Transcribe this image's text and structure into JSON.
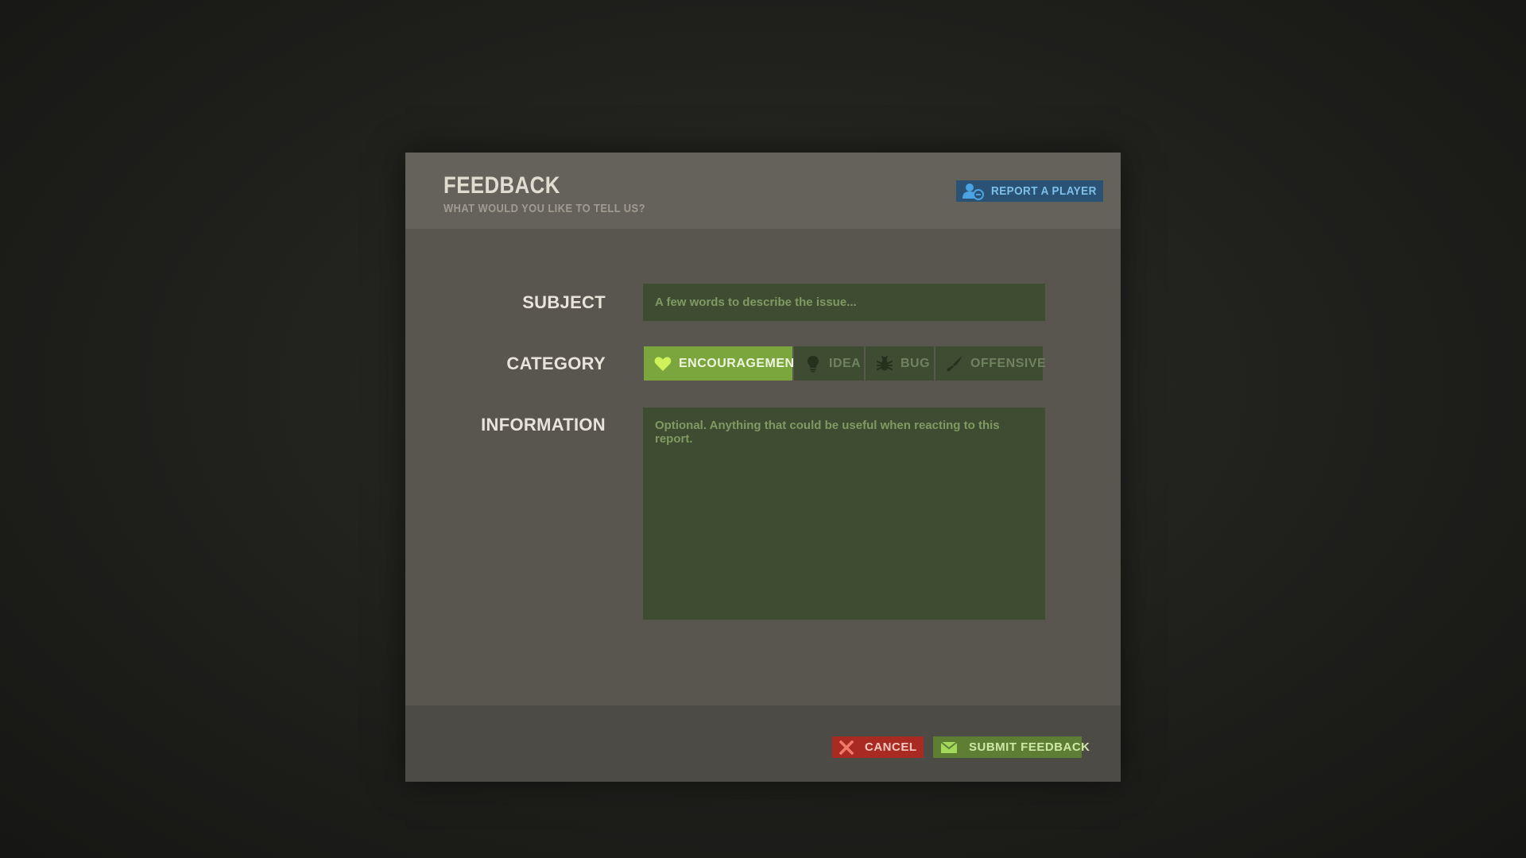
{
  "dialog": {
    "title": "FEEDBACK",
    "subtitle": "WHAT WOULD YOU LIKE TO TELL US?",
    "report_player_label": "REPORT A PLAYER",
    "report_player_icon": "user-report-icon"
  },
  "form": {
    "subject": {
      "label": "SUBJECT",
      "value": "",
      "placeholder": "A few words to describe the issue..."
    },
    "category": {
      "label": "CATEGORY",
      "selected": "ENCOURAGEMENT",
      "options": [
        {
          "label": "ENCOURAGEMENT",
          "icon": "heart-icon",
          "active": true
        },
        {
          "label": "IDEA",
          "icon": "lightbulb-icon",
          "active": false
        },
        {
          "label": "BUG",
          "icon": "bug-icon",
          "active": false
        },
        {
          "label": "OFFENSIVE",
          "icon": "knife-icon",
          "active": false
        }
      ]
    },
    "information": {
      "label": "INFORMATION",
      "value": "",
      "placeholder": "Optional. Anything that could be useful when reacting to this report."
    }
  },
  "footer": {
    "cancel_label": "CANCEL",
    "cancel_icon": "close-icon",
    "submit_label": "SUBMIT FEEDBACK",
    "submit_icon": "envelope-icon"
  },
  "colors": {
    "modal_bg": "#58564f",
    "input_bg": "#3e4c32",
    "active_category": "#7aa63d",
    "report_button": "#2a5274",
    "cancel_button": "#a82a22",
    "submit_button": "#5e7f33"
  }
}
